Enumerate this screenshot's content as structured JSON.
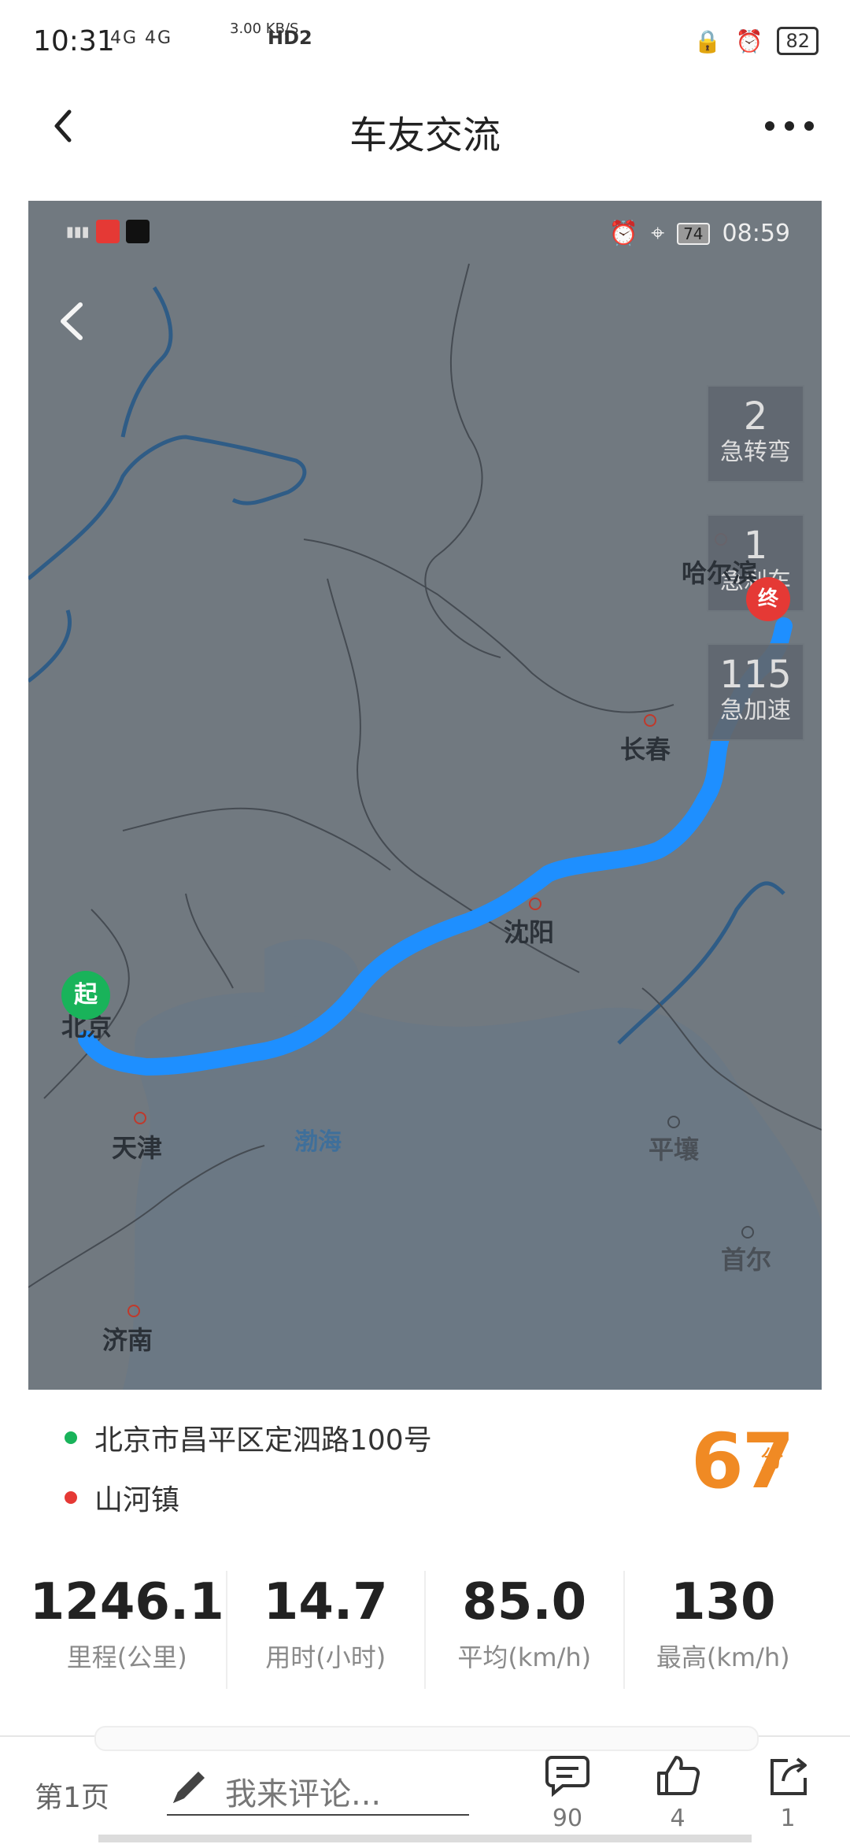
{
  "status_bar": {
    "time": "10:31",
    "network": "4G 4G",
    "speed": "3.00 KB/S",
    "hd": "HD2",
    "battery": "82"
  },
  "header": {
    "title": "车友交流"
  },
  "map": {
    "status": {
      "time": "08:59",
      "battery": "74"
    },
    "stats": [
      {
        "value": "2",
        "label": "急转弯"
      },
      {
        "value": "1",
        "label": "急刹车"
      },
      {
        "value": "115",
        "label": "急加速"
      }
    ],
    "cities": {
      "harbin": "哈尔滨",
      "changchun": "长春",
      "shenyang": "沈阳",
      "beijing": "北京",
      "tianjin": "天津",
      "bohai": "渤海",
      "pyongyang": "平壤",
      "jinan": "济南",
      "seoul": "首尔"
    },
    "start_label": "起",
    "end_label": "终"
  },
  "trip": {
    "start": "北京市昌平区定泗路100号",
    "end": "山河镇",
    "score": "67",
    "score_unit": "分",
    "start_color": "#19b35a",
    "end_color": "#e53935"
  },
  "metrics": [
    {
      "value": "1246.1",
      "label": "里程(公里)"
    },
    {
      "value": "14.7",
      "label": "用时(小时)"
    },
    {
      "value": "85.0",
      "label": "平均(km/h)"
    },
    {
      "value": "130",
      "label": "最高(km/h)"
    }
  ],
  "bottom": {
    "page": "第1页",
    "comment_placeholder": "我来评论...",
    "comments": "90",
    "likes": "4",
    "shares": "1"
  }
}
